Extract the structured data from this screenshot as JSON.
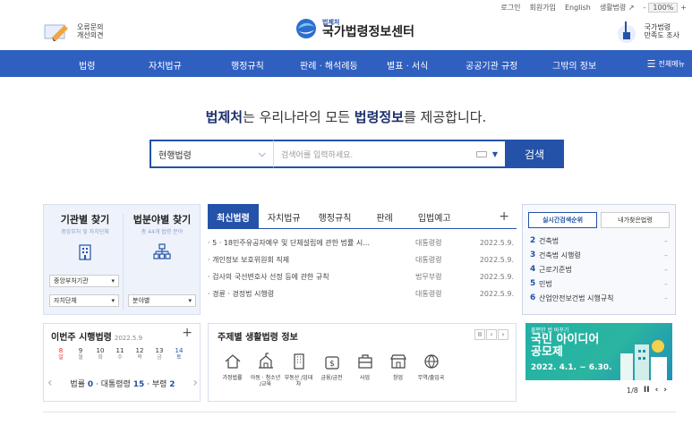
{
  "util": {
    "login": "로그인",
    "join": "회원가입",
    "english": "English",
    "life": "생활법령",
    "zoom": "100%",
    "zoom_minus": "-",
    "zoom_plus": "+"
  },
  "header": {
    "left_label_1": "오류문의",
    "left_label_2": "개선의견",
    "logo_sub": "법제처",
    "logo_main": "국가법령정보센터",
    "right_label_1": "국가법령",
    "right_label_2": "만족도 조사"
  },
  "nav": {
    "items": [
      "법령",
      "자치법규",
      "행정규칙",
      "판례 · 해석례등",
      "별표 · 서식",
      "공공기관 규정",
      "그밖의 정보"
    ],
    "all_menu": "전체메뉴"
  },
  "tagline": {
    "p1": "법제처",
    "p2": "는 우리나라의 모든 ",
    "p3": "법령정보",
    "p4": "를 제공합니다."
  },
  "search": {
    "select_value": "현행법령",
    "placeholder": "검색어를 입력하세요.",
    "button": "검색"
  },
  "finder": {
    "org_title": "기관별 찾기",
    "org_sub": "중앙부처 및 자치단체",
    "field_title": "법분야별 찾기",
    "field_sub": "총 44개 법령 분야",
    "dd_central": "중앙부처기관",
    "dd_local": "자치단체",
    "dd_field": "분야별"
  },
  "news": {
    "tabs": [
      "최신법령",
      "자치법규",
      "행정규칙",
      "판례",
      "입법예고"
    ],
    "plus": "+",
    "rows": [
      {
        "title": "· 5 · 18민주유공자예우 및 단체설립에 관한 법률 시…",
        "kind": "대통령령",
        "date": "2022.5.9."
      },
      {
        "title": "· 개인정보 보호위원회 직제",
        "kind": "대통령령",
        "date": "2022.5.9."
      },
      {
        "title": "· 검사의 국선변호사 선정 등에 관한 규칙",
        "kind": "법무부령",
        "date": "2022.5.9."
      },
      {
        "title": "· 경륜 · 경정법 시행령",
        "kind": "대통령령",
        "date": "2022.5.9."
      }
    ]
  },
  "rank": {
    "tab_active": "실시간검색순위",
    "tab_other": "내가찾은법령",
    "items": [
      {
        "n": "2",
        "name": "건축법",
        "chg": "–"
      },
      {
        "n": "3",
        "name": "건축법 시행령",
        "chg": "–"
      },
      {
        "n": "4",
        "name": "근로기준법",
        "chg": "–"
      },
      {
        "n": "5",
        "name": "민법",
        "chg": "–"
      },
      {
        "n": "6",
        "name": "산업안전보건법 시행규칙",
        "chg": "–"
      }
    ]
  },
  "weekly": {
    "title": "이번주 시행법령",
    "date": "2022.5.9",
    "plus": "+",
    "days": [
      {
        "d": "8",
        "w": "일"
      },
      {
        "d": "9",
        "w": "월"
      },
      {
        "d": "10",
        "w": "화"
      },
      {
        "d": "11",
        "w": "수"
      },
      {
        "d": "12",
        "w": "목"
      },
      {
        "d": "13",
        "w": "금"
      },
      {
        "d": "14",
        "w": "토"
      }
    ],
    "law_label": "법률",
    "law_count": "0",
    "decree_label": "· 대통령령",
    "decree_count": "15",
    "ministry_label": "· 부령",
    "ministry_count": "2"
  },
  "topic": {
    "title": "주제별 생활법령 정보",
    "items": [
      {
        "icon": "home-icon",
        "label": "가정법률"
      },
      {
        "icon": "school-icon",
        "label": "아동 · 청소년 /교육"
      },
      {
        "icon": "building-icon",
        "label": "부동산 /임대차"
      },
      {
        "icon": "money-icon",
        "label": "금융/금전"
      },
      {
        "icon": "briefcase-icon",
        "label": "사업"
      },
      {
        "icon": "store-icon",
        "label": "창업"
      },
      {
        "icon": "globe-icon",
        "label": "무역/출입국"
      }
    ]
  },
  "banner": {
    "top": "불편한 법 바꾸기",
    "big1": "국민 아이디어",
    "big2": "공모제",
    "date": "2022. 4.1. ~ 6.30.",
    "pager": "1/8"
  }
}
